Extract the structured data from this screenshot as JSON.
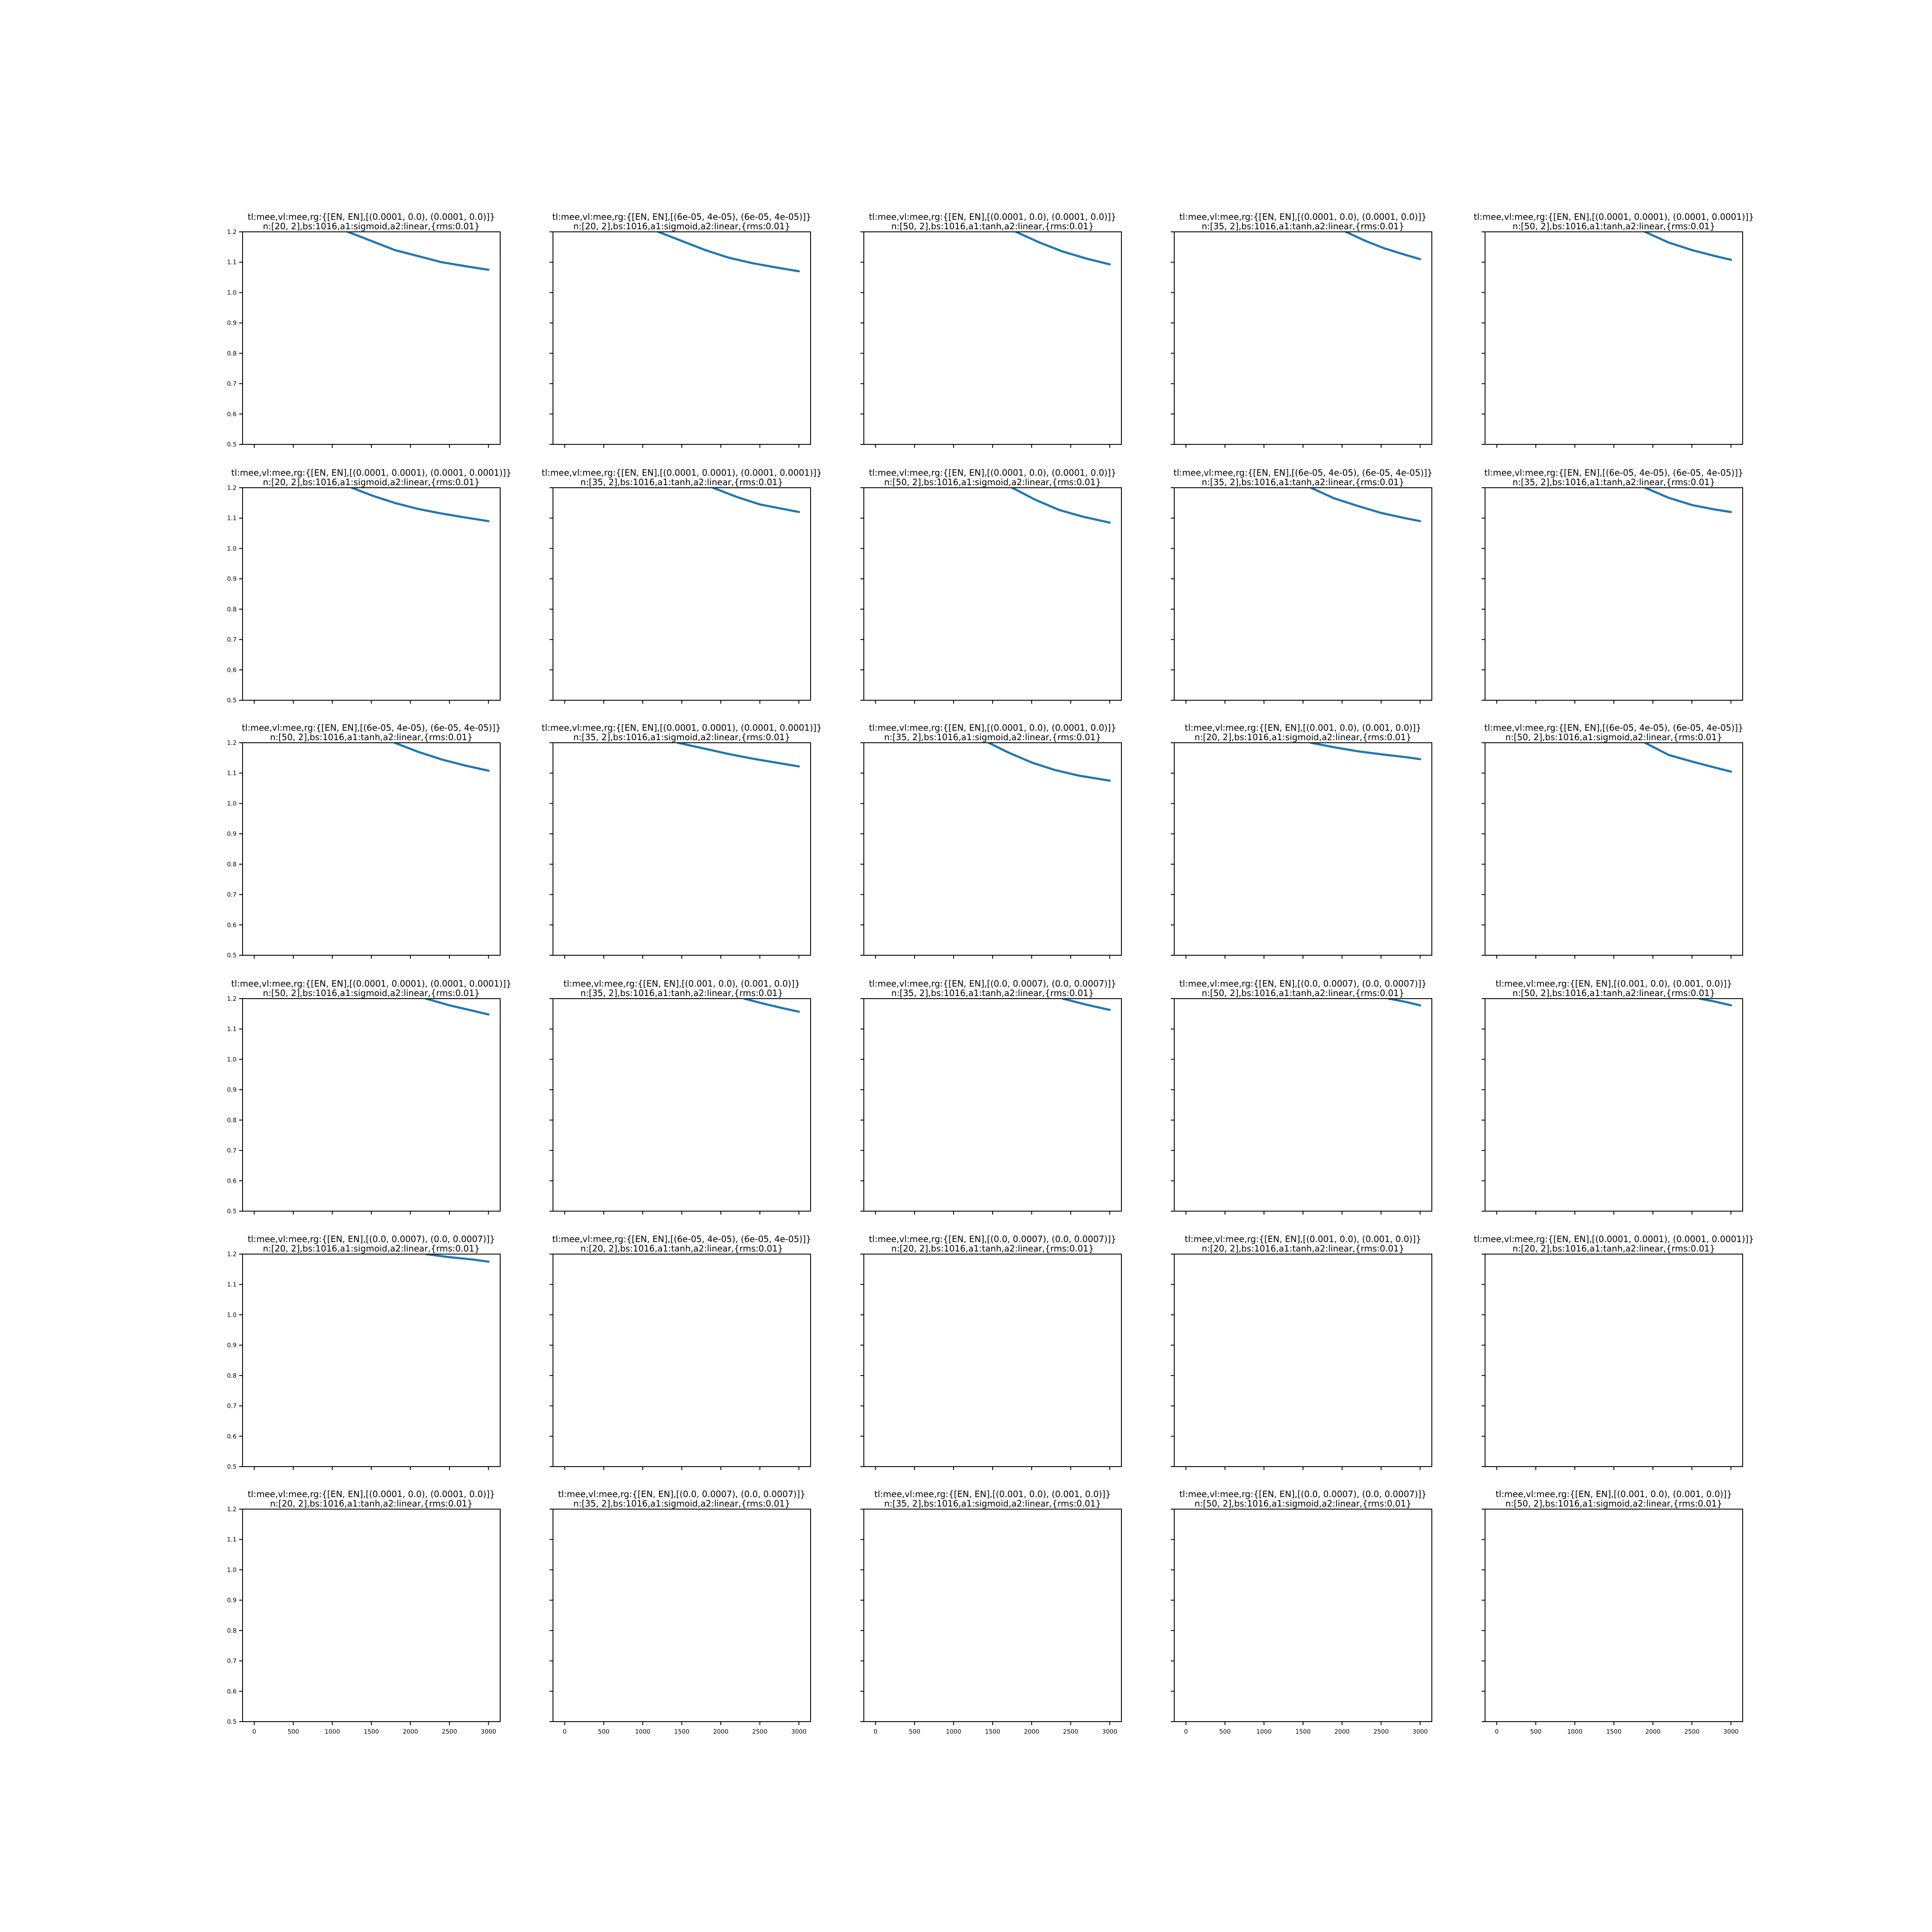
{
  "figure": {
    "rows": 6,
    "cols": 5,
    "line_color": "#1f77b4",
    "x_ticks": [
      0,
      500,
      1000,
      1500,
      2000,
      2500,
      3000
    ],
    "y_ticks": [
      0.5,
      0.6,
      0.7,
      0.8,
      0.9,
      1.0,
      1.1,
      1.2
    ]
  },
  "chart_data": [
    {
      "type": "line",
      "title": "tl:mee,vl:mee,rg:{[EN, EN],[(0.0001, 0.0), (0.0001, 0.0)]}",
      "subtitle": "n:[20, 2],bs:1016,a1:sigmoid,a2:linear,{rms:0.01}",
      "xlim": [
        -150,
        3150
      ],
      "ylim": [
        0.5,
        1.2
      ],
      "series": [
        {
          "x": [
            1200,
            1500,
            1800,
            2100,
            2400,
            2700,
            3000
          ],
          "y": [
            1.2,
            1.17,
            1.14,
            1.12,
            1.1,
            1.087,
            1.075
          ]
        }
      ]
    },
    {
      "type": "line",
      "title": "tl:mee,vl:mee,rg:{[EN, EN],[(6e-05, 4e-05), (6e-05, 4e-05)]}",
      "subtitle": "n:[20, 2],bs:1016,a1:sigmoid,a2:linear,{rms:0.01}",
      "xlim": [
        -150,
        3150
      ],
      "ylim": [
        0.5,
        1.2
      ],
      "series": [
        {
          "x": [
            1200,
            1500,
            1800,
            2100,
            2400,
            2700,
            3000
          ],
          "y": [
            1.2,
            1.17,
            1.14,
            1.115,
            1.097,
            1.083,
            1.07
          ]
        }
      ]
    },
    {
      "type": "line",
      "title": "tl:mee,vl:mee,rg:{[EN, EN],[(0.0001, 0.0), (0.0001, 0.0)]}",
      "subtitle": "n:[50, 2],bs:1016,a1:tanh,a2:linear,{rms:0.01}",
      "xlim": [
        -150,
        3150
      ],
      "ylim": [
        0.5,
        1.2
      ],
      "series": [
        {
          "x": [
            1800,
            2100,
            2400,
            2700,
            3000
          ],
          "y": [
            1.2,
            1.165,
            1.135,
            1.112,
            1.093
          ]
        }
      ]
    },
    {
      "type": "line",
      "title": "tl:mee,vl:mee,rg:{[EN, EN],[(0.0001, 0.0), (0.0001, 0.0)]}",
      "subtitle": "n:[35, 2],bs:1016,a1:tanh,a2:linear,{rms:0.01}",
      "xlim": [
        -150,
        3150
      ],
      "ylim": [
        0.5,
        1.2
      ],
      "series": [
        {
          "x": [
            2050,
            2300,
            2550,
            2800,
            3000
          ],
          "y": [
            1.2,
            1.17,
            1.145,
            1.125,
            1.11
          ]
        }
      ]
    },
    {
      "type": "line",
      "title": "tl:mee,vl:mee,rg:{[EN, EN],[(0.0001, 0.0001), (0.0001, 0.0001)]}",
      "subtitle": "n:[50, 2],bs:1016,a1:tanh,a2:linear,{rms:0.01}",
      "xlim": [
        -150,
        3150
      ],
      "ylim": [
        0.5,
        1.2
      ],
      "series": [
        {
          "x": [
            1900,
            2200,
            2500,
            2800,
            3000
          ],
          "y": [
            1.2,
            1.165,
            1.14,
            1.12,
            1.108
          ]
        }
      ]
    },
    {
      "type": "line",
      "title": "tl:mee,vl:mee,rg:{[EN, EN],[(0.0001, 0.0001), (0.0001, 0.0001)]}",
      "subtitle": "n:[20, 2],bs:1016,a1:sigmoid,a2:linear,{rms:0.01}",
      "xlim": [
        -150,
        3150
      ],
      "ylim": [
        0.5,
        1.2
      ],
      "series": [
        {
          "x": [
            1250,
            1500,
            1800,
            2100,
            2400,
            2700,
            3000
          ],
          "y": [
            1.2,
            1.175,
            1.15,
            1.13,
            1.115,
            1.102,
            1.09
          ]
        }
      ]
    },
    {
      "type": "line",
      "title": "tl:mee,vl:mee,rg:{[EN, EN],[(0.0001, 0.0001), (0.0001, 0.0001)]}",
      "subtitle": "n:[35, 2],bs:1016,a1:tanh,a2:linear,{rms:0.01}",
      "xlim": [
        -150,
        3150
      ],
      "ylim": [
        0.5,
        1.2
      ],
      "series": [
        {
          "x": [
            1900,
            2200,
            2500,
            2800,
            3000
          ],
          "y": [
            1.2,
            1.17,
            1.145,
            1.13,
            1.12
          ]
        }
      ]
    },
    {
      "type": "line",
      "title": "tl:mee,vl:mee,rg:{[EN, EN],[(0.0001, 0.0), (0.0001, 0.0)]}",
      "subtitle": "n:[50, 2],bs:1016,a1:sigmoid,a2:linear,{rms:0.01}",
      "xlim": [
        -150,
        3150
      ],
      "ylim": [
        0.5,
        1.2
      ],
      "series": [
        {
          "x": [
            1750,
            2050,
            2350,
            2650,
            3000
          ],
          "y": [
            1.2,
            1.16,
            1.127,
            1.105,
            1.085
          ]
        }
      ]
    },
    {
      "type": "line",
      "title": "tl:mee,vl:mee,rg:{[EN, EN],[(6e-05, 4e-05), (6e-05, 4e-05)]}",
      "subtitle": "n:[35, 2],bs:1016,a1:tanh,a2:linear,{rms:0.01}",
      "xlim": [
        -150,
        3150
      ],
      "ylim": [
        0.5,
        1.2
      ],
      "series": [
        {
          "x": [
            1600,
            1900,
            2200,
            2500,
            2800,
            3000
          ],
          "y": [
            1.2,
            1.165,
            1.14,
            1.117,
            1.1,
            1.09
          ]
        }
      ]
    },
    {
      "type": "line",
      "title": "tl:mee,vl:mee,rg:{[EN, EN],[(6e-05, 4e-05), (6e-05, 4e-05)]}",
      "subtitle": "n:[35, 2],bs:1016,a1:tanh,a2:linear,{rms:0.01}",
      "xlim": [
        -150,
        3150
      ],
      "ylim": [
        0.5,
        1.2
      ],
      "series": [
        {
          "x": [
            1900,
            2200,
            2500,
            2800,
            3000
          ],
          "y": [
            1.2,
            1.167,
            1.143,
            1.128,
            1.12
          ]
        }
      ]
    },
    {
      "type": "line",
      "title": "tl:mee,vl:mee,rg:{[EN, EN],[(6e-05, 4e-05), (6e-05, 4e-05)]}",
      "subtitle": "n:[50, 2],bs:1016,a1:tanh,a2:linear,{rms:0.01}",
      "xlim": [
        -150,
        3150
      ],
      "ylim": [
        0.5,
        1.2
      ],
      "series": [
        {
          "x": [
            1800,
            2100,
            2400,
            2700,
            3000
          ],
          "y": [
            1.2,
            1.17,
            1.145,
            1.125,
            1.108
          ]
        }
      ]
    },
    {
      "type": "line",
      "title": "tl:mee,vl:mee,rg:{[EN, EN],[(0.0001, 0.0001), (0.0001, 0.0001)]}",
      "subtitle": "n:[35, 2],bs:1016,a1:sigmoid,a2:linear,{rms:0.01}",
      "xlim": [
        -150,
        3150
      ],
      "ylim": [
        0.5,
        1.2
      ],
      "series": [
        {
          "x": [
            1450,
            1800,
            2100,
            2400,
            2700,
            3000
          ],
          "y": [
            1.2,
            1.18,
            1.163,
            1.148,
            1.135,
            1.122
          ]
        }
      ]
    },
    {
      "type": "line",
      "title": "tl:mee,vl:mee,rg:{[EN, EN],[(0.0001, 0.0), (0.0001, 0.0)]}",
      "subtitle": "n:[35, 2],bs:1016,a1:sigmoid,a2:linear,{rms:0.01}",
      "xlim": [
        -150,
        3150
      ],
      "ylim": [
        0.5,
        1.2
      ],
      "series": [
        {
          "x": [
            1450,
            1700,
            2000,
            2300,
            2600,
            3000
          ],
          "y": [
            1.2,
            1.168,
            1.135,
            1.11,
            1.092,
            1.075
          ]
        }
      ]
    },
    {
      "type": "line",
      "title": "tl:mee,vl:mee,rg:{[EN, EN],[(0.001, 0.0), (0.001, 0.0)]}",
      "subtitle": "n:[20, 2],bs:1016,a1:sigmoid,a2:linear,{rms:0.01}",
      "xlim": [
        -150,
        3150
      ],
      "ylim": [
        0.5,
        1.2
      ],
      "series": [
        {
          "x": [
            1600,
            1900,
            2200,
            2500,
            2800,
            3000
          ],
          "y": [
            1.2,
            1.185,
            1.172,
            1.162,
            1.153,
            1.146
          ]
        }
      ]
    },
    {
      "type": "line",
      "title": "tl:mee,vl:mee,rg:{[EN, EN],[(6e-05, 4e-05), (6e-05, 4e-05)]}",
      "subtitle": "n:[50, 2],bs:1016,a1:sigmoid,a2:linear,{rms:0.01}",
      "xlim": [
        -150,
        3150
      ],
      "ylim": [
        0.5,
        1.2
      ],
      "series": [
        {
          "x": [
            1900,
            2200,
            2500,
            2800,
            3000
          ],
          "y": [
            1.2,
            1.16,
            1.138,
            1.118,
            1.105
          ]
        }
      ]
    },
    {
      "type": "line",
      "title": "tl:mee,vl:mee,rg:{[EN, EN],[(0.0001, 0.0001), (0.0001, 0.0001)]}",
      "subtitle": "n:[50, 2],bs:1016,a1:sigmoid,a2:linear,{rms:0.01}",
      "xlim": [
        -150,
        3150
      ],
      "ylim": [
        0.5,
        1.2
      ],
      "series": [
        {
          "x": [
            2200,
            2500,
            2800,
            3000
          ],
          "y": [
            1.2,
            1.178,
            1.16,
            1.148
          ]
        }
      ]
    },
    {
      "type": "line",
      "title": "tl:mee,vl:mee,rg:{[EN, EN],[(0.001, 0.0), (0.001, 0.0)]}",
      "subtitle": "n:[35, 2],bs:1016,a1:tanh,a2:linear,{rms:0.01}",
      "xlim": [
        -150,
        3150
      ],
      "ylim": [
        0.5,
        1.2
      ],
      "series": [
        {
          "x": [
            2300,
            2600,
            2800,
            3000
          ],
          "y": [
            1.2,
            1.18,
            1.168,
            1.157
          ]
        }
      ]
    },
    {
      "type": "line",
      "title": "tl:mee,vl:mee,rg:{[EN, EN],[(0.0, 0.0007), (0.0, 0.0007)]}",
      "subtitle": "n:[35, 2],bs:1016,a1:tanh,a2:linear,{rms:0.01}",
      "xlim": [
        -150,
        3150
      ],
      "ylim": [
        0.5,
        1.2
      ],
      "series": [
        {
          "x": [
            2400,
            2700,
            3000
          ],
          "y": [
            1.2,
            1.18,
            1.163
          ]
        }
      ]
    },
    {
      "type": "line",
      "title": "tl:mee,vl:mee,rg:{[EN, EN],[(0.0, 0.0007), (0.0, 0.0007)]}",
      "subtitle": "n:[50, 2],bs:1016,a1:tanh,a2:linear,{rms:0.01}",
      "xlim": [
        -150,
        3150
      ],
      "ylim": [
        0.5,
        1.2
      ],
      "series": [
        {
          "x": [
            2600,
            2800,
            3000
          ],
          "y": [
            1.2,
            1.19,
            1.178
          ]
        }
      ]
    },
    {
      "type": "line",
      "title": "tl:mee,vl:mee,rg:{[EN, EN],[(0.001, 0.0), (0.001, 0.0)]}",
      "subtitle": "n:[50, 2],bs:1016,a1:tanh,a2:linear,{rms:0.01}",
      "xlim": [
        -150,
        3150
      ],
      "ylim": [
        0.5,
        1.2
      ],
      "series": [
        {
          "x": [
            2600,
            2800,
            3000
          ],
          "y": [
            1.2,
            1.19,
            1.178
          ]
        }
      ]
    },
    {
      "type": "line",
      "title": "tl:mee,vl:mee,rg:{[EN, EN],[(0.0, 0.0007), (0.0, 0.0007)]}",
      "subtitle": "n:[20, 2],bs:1016,a1:sigmoid,a2:linear,{rms:0.01}",
      "xlim": [
        -150,
        3150
      ],
      "ylim": [
        0.5,
        1.2
      ],
      "series": [
        {
          "x": [
            2200,
            2500,
            2800,
            3000
          ],
          "y": [
            1.2,
            1.19,
            1.182,
            1.175
          ]
        }
      ]
    },
    {
      "type": "line",
      "title": "tl:mee,vl:mee,rg:{[EN, EN],[(6e-05, 4e-05), (6e-05, 4e-05)]}",
      "subtitle": "n:[20, 2],bs:1016,a1:tanh,a2:linear,{rms:0.01}",
      "xlim": [
        -150,
        3150
      ],
      "ylim": [
        0.5,
        1.2
      ],
      "series": []
    },
    {
      "type": "line",
      "title": "tl:mee,vl:mee,rg:{[EN, EN],[(0.0, 0.0007), (0.0, 0.0007)]}",
      "subtitle": "n:[20, 2],bs:1016,a1:tanh,a2:linear,{rms:0.01}",
      "xlim": [
        -150,
        3150
      ],
      "ylim": [
        0.5,
        1.2
      ],
      "series": []
    },
    {
      "type": "line",
      "title": "tl:mee,vl:mee,rg:{[EN, EN],[(0.001, 0.0), (0.001, 0.0)]}",
      "subtitle": "n:[20, 2],bs:1016,a1:tanh,a2:linear,{rms:0.01}",
      "xlim": [
        -150,
        3150
      ],
      "ylim": [
        0.5,
        1.2
      ],
      "series": []
    },
    {
      "type": "line",
      "title": "tl:mee,vl:mee,rg:{[EN, EN],[(0.0001, 0.0001), (0.0001, 0.0001)]}",
      "subtitle": "n:[20, 2],bs:1016,a1:tanh,a2:linear,{rms:0.01}",
      "xlim": [
        -150,
        3150
      ],
      "ylim": [
        0.5,
        1.2
      ],
      "series": []
    },
    {
      "type": "line",
      "title": "tl:mee,vl:mee,rg:{[EN, EN],[(0.0001, 0.0), (0.0001, 0.0)]}",
      "subtitle": "n:[20, 2],bs:1016,a1:tanh,a2:linear,{rms:0.01}",
      "xlim": [
        -150,
        3150
      ],
      "ylim": [
        0.5,
        1.2
      ],
      "series": []
    },
    {
      "type": "line",
      "title": "tl:mee,vl:mee,rg:{[EN, EN],[(0.0, 0.0007), (0.0, 0.0007)]}",
      "subtitle": "n:[35, 2],bs:1016,a1:sigmoid,a2:linear,{rms:0.01}",
      "xlim": [
        -150,
        3150
      ],
      "ylim": [
        0.5,
        1.2
      ],
      "series": []
    },
    {
      "type": "line",
      "title": "tl:mee,vl:mee,rg:{[EN, EN],[(0.001, 0.0), (0.001, 0.0)]}",
      "subtitle": "n:[35, 2],bs:1016,a1:sigmoid,a2:linear,{rms:0.01}",
      "xlim": [
        -150,
        3150
      ],
      "ylim": [
        0.5,
        1.2
      ],
      "series": []
    },
    {
      "type": "line",
      "title": "tl:mee,vl:mee,rg:{[EN, EN],[(0.0, 0.0007), (0.0, 0.0007)]}",
      "subtitle": "n:[50, 2],bs:1016,a1:sigmoid,a2:linear,{rms:0.01}",
      "xlim": [
        -150,
        3150
      ],
      "ylim": [
        0.5,
        1.2
      ],
      "series": []
    },
    {
      "type": "line",
      "title": "tl:mee,vl:mee,rg:{[EN, EN],[(0.001, 0.0), (0.001, 0.0)]}",
      "subtitle": "n:[50, 2],bs:1016,a1:sigmoid,a2:linear,{rms:0.01}",
      "xlim": [
        -150,
        3150
      ],
      "ylim": [
        0.5,
        1.2
      ],
      "series": []
    }
  ]
}
